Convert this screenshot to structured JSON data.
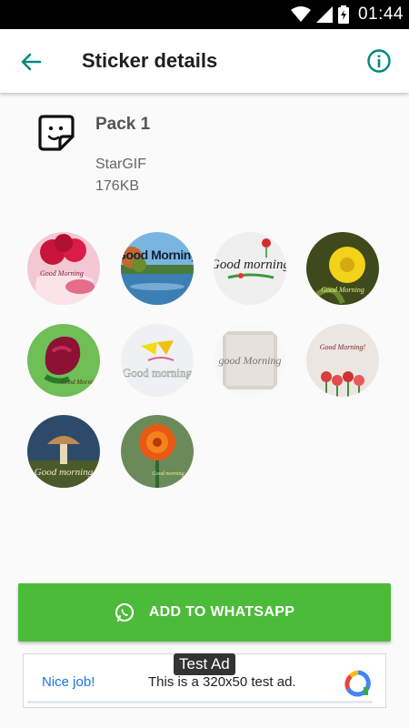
{
  "status_bar": {
    "time": "01:44",
    "icons": [
      "wifi-icon",
      "signal-icon",
      "battery-icon"
    ]
  },
  "app_bar": {
    "title": "Sticker details",
    "back_icon": "arrow-back-icon",
    "info_icon": "info-icon",
    "accent_color": "#00897b"
  },
  "pack": {
    "name": "Pack 1",
    "publisher": "StarGIF",
    "size": "176KB",
    "icon": "sticker-icon"
  },
  "stickers": [
    {
      "name": "sticker-1",
      "text": "Good Morning",
      "theme": "pink roses"
    },
    {
      "name": "sticker-2",
      "text": "Good Morning",
      "theme": "lake"
    },
    {
      "name": "sticker-3",
      "text": "Good morning",
      "theme": "white flowers"
    },
    {
      "name": "sticker-4",
      "text": "Good Morning",
      "theme": "yellow flower"
    },
    {
      "name": "sticker-5",
      "text": "Good Morning",
      "theme": "red rose"
    },
    {
      "name": "sticker-6",
      "text": "Good morning",
      "theme": "yellow butterfly"
    },
    {
      "name": "sticker-7",
      "text": "good Morning",
      "theme": "sketch"
    },
    {
      "name": "sticker-8",
      "text": "Good Morning!",
      "theme": "tulips"
    },
    {
      "name": "sticker-9",
      "text": "Good morning",
      "theme": "mushrooms"
    },
    {
      "name": "sticker-10",
      "text": "Good morning",
      "theme": "marigold"
    }
  ],
  "add_button": {
    "label": "ADD TO WHATSAPP",
    "icon": "whatsapp-icon",
    "color": "#4dbb3a"
  },
  "ad": {
    "badge": "Test Ad",
    "nice": "Nice job!",
    "text": "This is a 320x50 test ad.",
    "logo": "ad-logo-icon"
  }
}
